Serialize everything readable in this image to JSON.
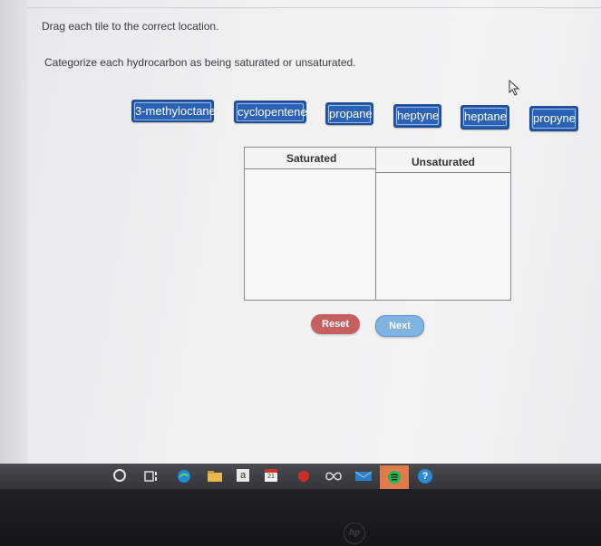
{
  "instructions": {
    "drag": "Drag each tile to the correct location.",
    "task": "Categorize each hydrocarbon as being saturated or unsaturated."
  },
  "tiles": [
    {
      "label": "3-methyloctane"
    },
    {
      "label": "cyclopentene"
    },
    {
      "label": "propane"
    },
    {
      "label": "heptyne"
    },
    {
      "label": "heptane"
    },
    {
      "label": "propyne"
    }
  ],
  "table": {
    "columns": [
      "Saturated",
      "Unsaturated"
    ]
  },
  "buttons": {
    "reset": "Reset",
    "next": "Next"
  },
  "taskbar": {
    "calendar_day": "21",
    "text_icon": "a",
    "help_icon": "?"
  },
  "bezel": {
    "logo": "hp"
  },
  "colors": {
    "tile": "#2b62b6",
    "reset": "#c45f62",
    "next": "#7fb3e0"
  }
}
